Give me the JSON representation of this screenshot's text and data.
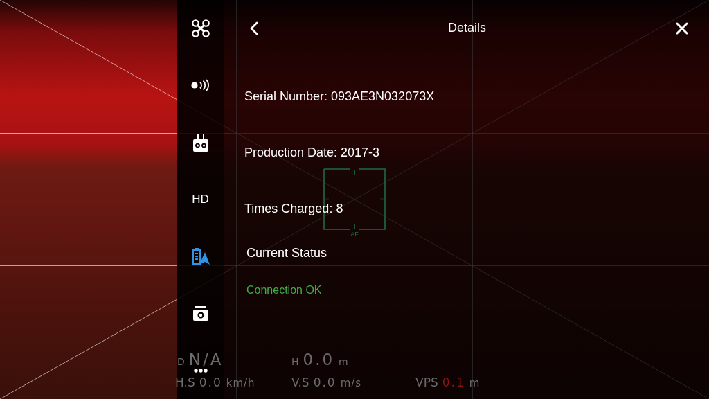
{
  "camera_view": {
    "focus_label": "AF"
  },
  "sidebar": {
    "items": [
      {
        "kind": "aircraft",
        "selected": false
      },
      {
        "kind": "transmission",
        "selected": false
      },
      {
        "kind": "controller",
        "selected": false
      },
      {
        "kind": "text",
        "label": "HD",
        "selected": false
      },
      {
        "kind": "battery",
        "selected": true
      },
      {
        "kind": "camera",
        "selected": false
      },
      {
        "kind": "more",
        "selected": false
      }
    ]
  },
  "panel": {
    "title": "Details",
    "fields": [
      {
        "label": "Serial Number:",
        "value": "093AE3N032073X"
      },
      {
        "label": "Production Date:",
        "value": "2017-3"
      },
      {
        "label": "Times Charged:",
        "value": "8"
      }
    ],
    "status": {
      "heading": "Current Status",
      "message": "Connection OK",
      "kind": "ok"
    }
  },
  "telemetry": {
    "rows": [
      [
        {
          "label": "D",
          "value": "N/A",
          "warning": false
        },
        {
          "label": "H",
          "value": "0.0",
          "unit": "m",
          "warning": false
        }
      ],
      [
        {
          "label": "H.S",
          "value": "0.0",
          "unit": "km/h",
          "warning": false
        },
        {
          "label": "V.S",
          "value": "0.0",
          "unit": "m/s",
          "warning": false
        },
        {
          "label": "VPS",
          "value": "0.1",
          "unit": "m",
          "warning": true
        }
      ]
    ]
  }
}
